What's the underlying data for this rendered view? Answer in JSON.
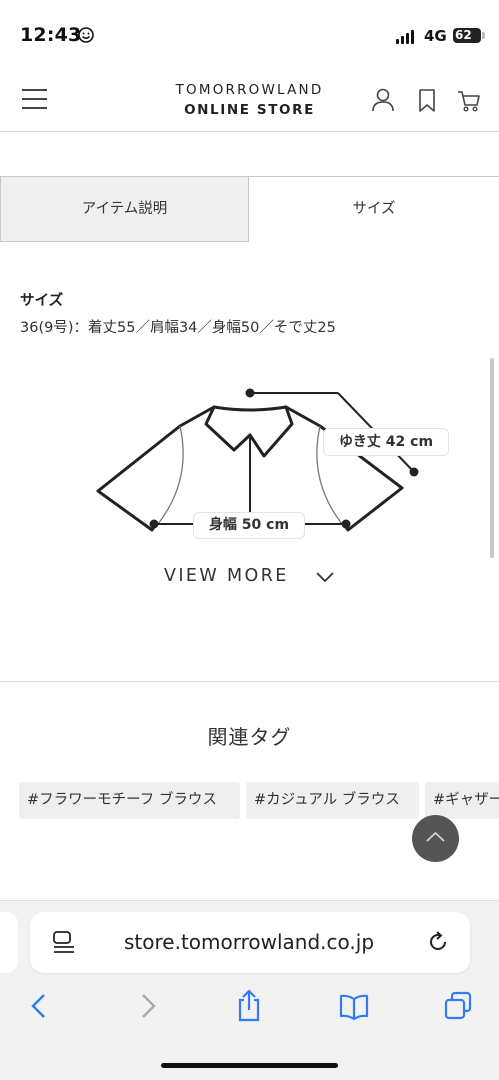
{
  "status_bar": {
    "time": "12:43",
    "network": "4G",
    "battery": "62"
  },
  "header": {
    "brand_line1": "TOMORROWLAND",
    "brand_line2": "ONLINE STORE",
    "icons": [
      "menu-icon",
      "account-icon",
      "bookmark-icon",
      "cart-icon"
    ]
  },
  "tabs": [
    {
      "label": "アイテム説明",
      "selected": false
    },
    {
      "label": "サイズ",
      "selected": true
    }
  ],
  "size": {
    "title": "サイズ",
    "description": "36(9号)：着丈55／肩幅34／身幅50／そで丈25"
  },
  "diagram": {
    "yuki_label": "ゆき丈 42 cm",
    "mihaba_label": "身幅 50 cm"
  },
  "view_more": "VIEW MORE",
  "related": {
    "title": "関連タグ",
    "tags": [
      "#フラワーモチーフ ブラウス",
      "#カジュアル ブラウス",
      "#ギャザー"
    ]
  },
  "browser": {
    "url": "store.tomorrowland.co.jp",
    "icons": [
      "back-icon",
      "forward-icon",
      "share-icon",
      "bookmarks-icon",
      "tabs-icon"
    ]
  },
  "colors": {
    "tab_inactive_bg": "#efefef",
    "tag_bg": "#efefef",
    "to_top_bg": "#555555",
    "browser_bg": "#f2f2f2",
    "link_blue": "#2f7cf6"
  }
}
